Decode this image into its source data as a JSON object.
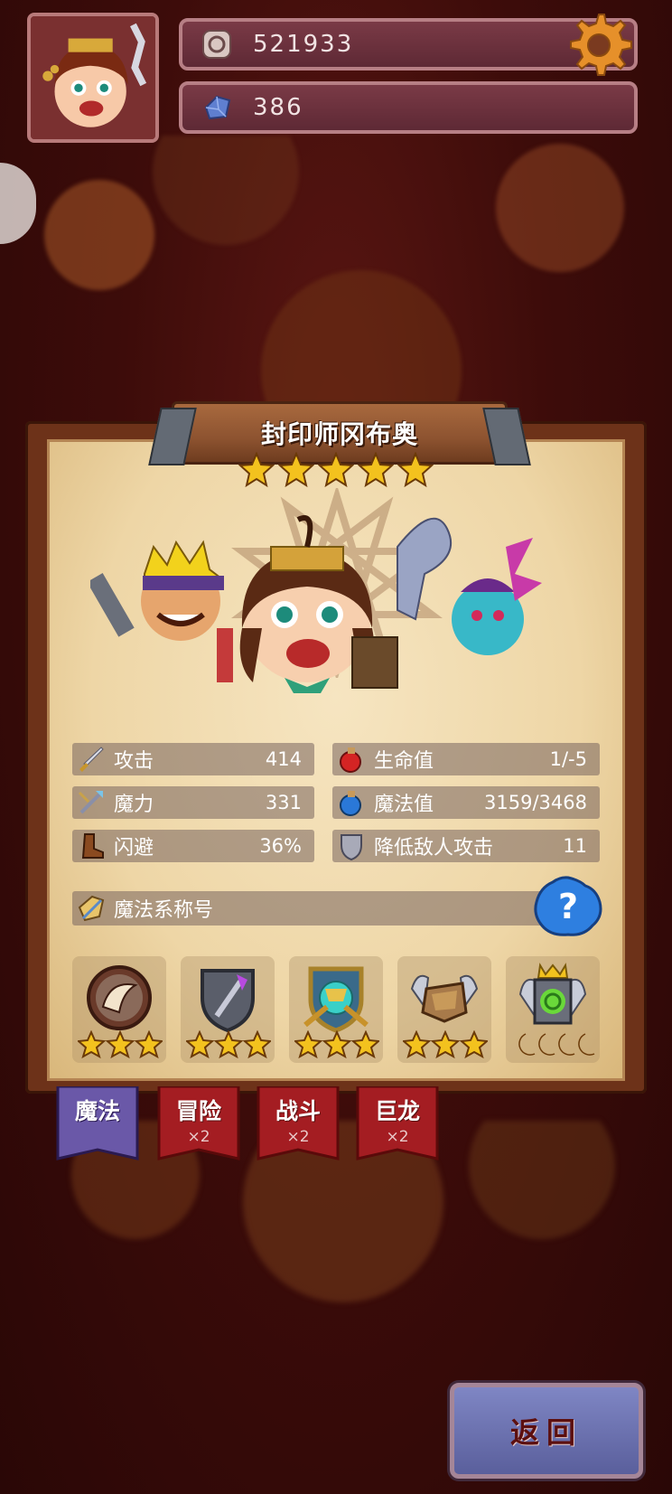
{
  "resources": {
    "gold": {
      "value": "521933",
      "icon": "coin-icon"
    },
    "gems": {
      "value": "386",
      "icon": "gem-icon"
    }
  },
  "hero": {
    "name": "封印师冈布奥",
    "rank_stars": 5
  },
  "stats": [
    {
      "label": "攻击",
      "value": "414",
      "icon": "sword-icon"
    },
    {
      "label": "生命值",
      "value": "1/-5",
      "icon": "health-potion-icon"
    },
    {
      "label": "魔力",
      "value": "331",
      "icon": "magic-staff-icon"
    },
    {
      "label": "魔法值",
      "value": "3159/3468",
      "icon": "mana-potion-icon"
    },
    {
      "label": "闪避",
      "value": "36%",
      "icon": "boot-icon"
    },
    {
      "label": "降低敌人攻击",
      "value": "11",
      "icon": "shield-icon"
    }
  ],
  "title_row": {
    "label": "魔法系称号",
    "icon": "magic-title-icon",
    "help_icon": "question-icon"
  },
  "badges": [
    {
      "name": "horn-badge-icon",
      "stars": 3,
      "type": "star"
    },
    {
      "name": "wand-shield-badge-icon",
      "stars": 3,
      "type": "star"
    },
    {
      "name": "crossed-staves-badge-icon",
      "stars": 3,
      "type": "star"
    },
    {
      "name": "winged-rock-badge-icon",
      "stars": 3,
      "type": "star"
    },
    {
      "name": "crowned-portal-badge-icon",
      "stars": 4,
      "type": "moon"
    }
  ],
  "tabs": [
    {
      "label": "魔法",
      "mult": "",
      "active": true
    },
    {
      "label": "冒险",
      "mult": "×2",
      "active": false
    },
    {
      "label": "战斗",
      "mult": "×2",
      "active": false
    },
    {
      "label": "巨龙",
      "mult": "×2",
      "active": false
    }
  ],
  "back_button": {
    "label": "返回"
  },
  "colors": {
    "background": "#3d0c0a",
    "panel_paper": "#f1dcb2",
    "stat_bar": "#7a645f",
    "tab_active": "#6a58a8",
    "tab_inactive": "#a41d22",
    "back_button": "#6c72b0"
  }
}
